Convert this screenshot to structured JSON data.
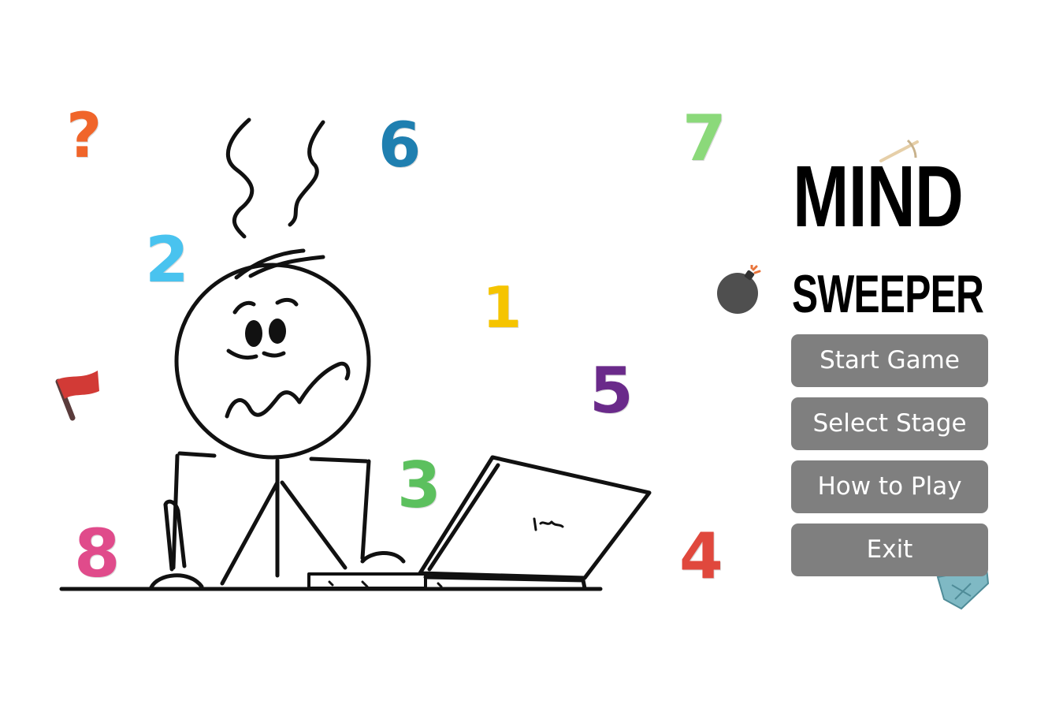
{
  "title": {
    "main": "MIND",
    "sub": "SWEEPER"
  },
  "menu": {
    "start_label": "Start Game",
    "select_label": "Select Stage",
    "howto_label": "How to Play",
    "exit_label": "Exit"
  },
  "decorations": {
    "numbers": [
      {
        "char": "?",
        "color": "#f0652a"
      },
      {
        "char": "6",
        "color": "#1f7fb0"
      },
      {
        "char": "7",
        "color": "#8bd97a"
      },
      {
        "char": "2",
        "color": "#49c3ef"
      },
      {
        "char": "1",
        "color": "#f5c400"
      },
      {
        "char": "5",
        "color": "#6a2a8a"
      },
      {
        "char": "3",
        "color": "#5cc05e"
      },
      {
        "char": "8",
        "color": "#e04b8b"
      },
      {
        "char": "4",
        "color": "#e0483d"
      }
    ],
    "icons": [
      "flag-icon",
      "bomb-icon",
      "gem-icon",
      "pickaxe-icon",
      "stickman-illustration",
      "laptop-illustration"
    ]
  },
  "colors": {
    "button_bg": "#7f7f7f",
    "button_text": "#ffffff",
    "title_text": "#000000"
  }
}
